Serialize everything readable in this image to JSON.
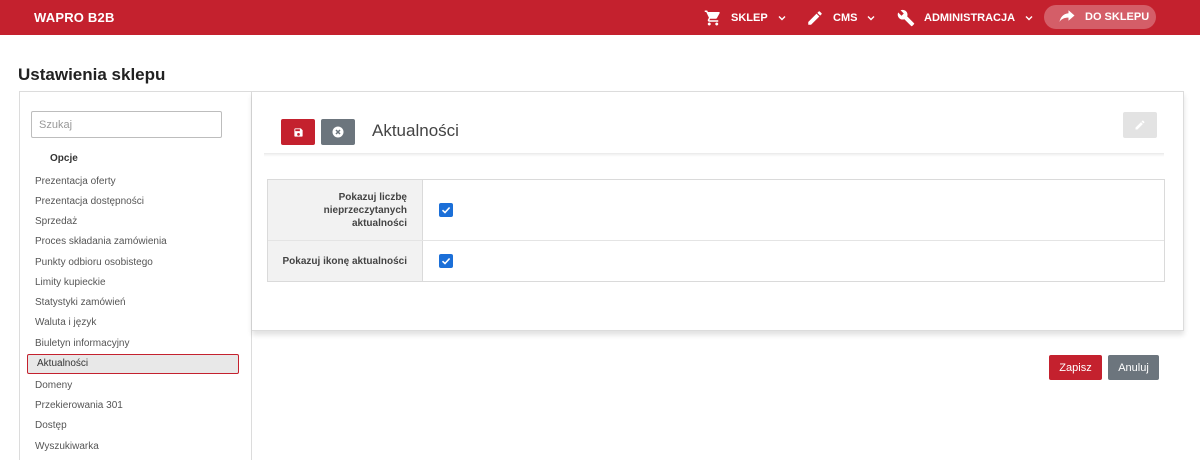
{
  "header": {
    "brand": "WAPRO B2B",
    "nav": [
      {
        "label": "SKLEP",
        "icon": "cart-icon"
      },
      {
        "label": "CMS",
        "icon": "pencil-icon"
      },
      {
        "label": "ADMINISTRACJA",
        "icon": "wrench-icon"
      }
    ],
    "store_button": "DO SKLEPU",
    "accent_color": "#c4212e"
  },
  "page_title": "Ustawienia sklepu",
  "sidebar": {
    "search_placeholder": "Szukaj",
    "section_title": "Opcje",
    "items": [
      "Prezentacja oferty",
      "Prezentacja dostępności",
      "Sprzedaż",
      "Proces składania zamówienia",
      "Punkty odbioru osobistego",
      "Limity kupieckie",
      "Statystyki zamówień",
      "Waluta i język",
      "Biuletyn informacyjny",
      "Aktualności",
      "Domeny",
      "Przekierowania 301",
      "Dostęp",
      "Wyszukiwarka"
    ],
    "active_item": "Aktualności"
  },
  "panel": {
    "title": "Aktualności",
    "settings": [
      {
        "label": "Pokazuj liczbę nieprzeczytanych aktualności",
        "checked": true
      },
      {
        "label": "Pokazuj ikonę aktualności",
        "checked": true
      }
    ]
  },
  "footer_buttons": {
    "save": "Zapisz",
    "cancel": "Anuluj"
  }
}
